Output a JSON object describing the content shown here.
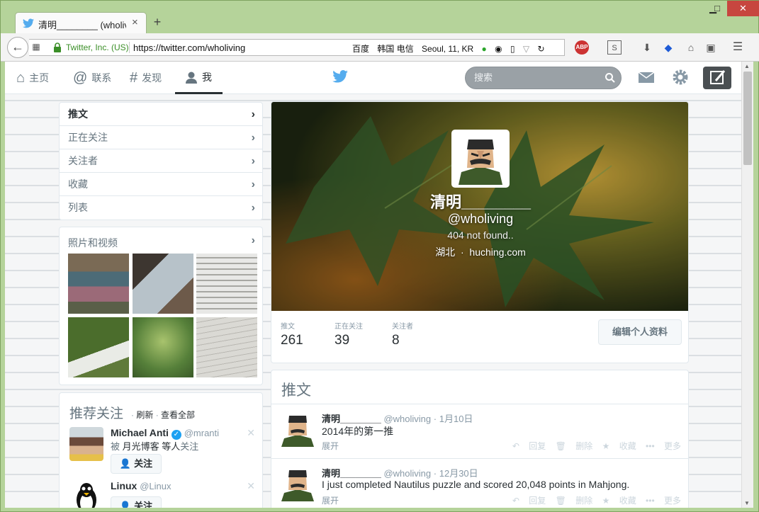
{
  "browser": {
    "tab_title": "清明________ (wholivi...",
    "tab_close": "×",
    "new_tab": "+",
    "win_min": "▁",
    "win_max": "□",
    "win_close": "✕",
    "identity": "Twitter, Inc. (US)",
    "url": "https://twitter.com/wholiving",
    "url_extras": [
      "百度",
      "韩国 电信",
      "Seoul, 11, KR"
    ]
  },
  "nav": {
    "home": "主页",
    "connect": "联系",
    "discover": "发现",
    "me": "我",
    "search_placeholder": "搜索"
  },
  "menu": {
    "items": [
      {
        "label": "推文"
      },
      {
        "label": "正在关注"
      },
      {
        "label": "关注者"
      },
      {
        "label": "收藏"
      },
      {
        "label": "列表"
      }
    ]
  },
  "media": {
    "title": "照片和视频"
  },
  "wtf": {
    "title": "推荐关注",
    "refresh": "刷新",
    "view_all": "查看全部",
    "dot": "·",
    "follow_label": "关注",
    "people": [
      {
        "name": "Michael Anti",
        "handle": "@mranti",
        "by_prefix": "被",
        "by": "月光博客 等人",
        "by_suffix": "关注"
      },
      {
        "name": "Linux",
        "handle": "@Linux"
      }
    ]
  },
  "profile": {
    "name": "清明________",
    "handle": "@wholiving",
    "bio": "404 not found..",
    "location": "湖北",
    "separator": "·",
    "website": "huching.com",
    "stats": [
      {
        "label": "推文",
        "value": "261"
      },
      {
        "label": "正在关注",
        "value": "39"
      },
      {
        "label": "关注者",
        "value": "8"
      }
    ],
    "edit_button": "编辑个人资料"
  },
  "timeline": {
    "title": "推文",
    "expand": "展开",
    "actions": {
      "reply": "回复",
      "delete": "删除",
      "favorite": "收藏",
      "more": "更多"
    },
    "tweets": [
      {
        "name": "清明________",
        "handle": "@wholiving",
        "date": "1月10日",
        "text": "2014年的第一推"
      },
      {
        "name": "清明________",
        "handle": "@wholiving",
        "date": "12月30日",
        "text": "I just completed Nautilus puzzle and scored 20,048 points in Mahjong."
      }
    ]
  },
  "colors": {
    "twitter_blue": "#55acee",
    "verified": "#1da1f2",
    "lock_green": "#3a8e27"
  }
}
